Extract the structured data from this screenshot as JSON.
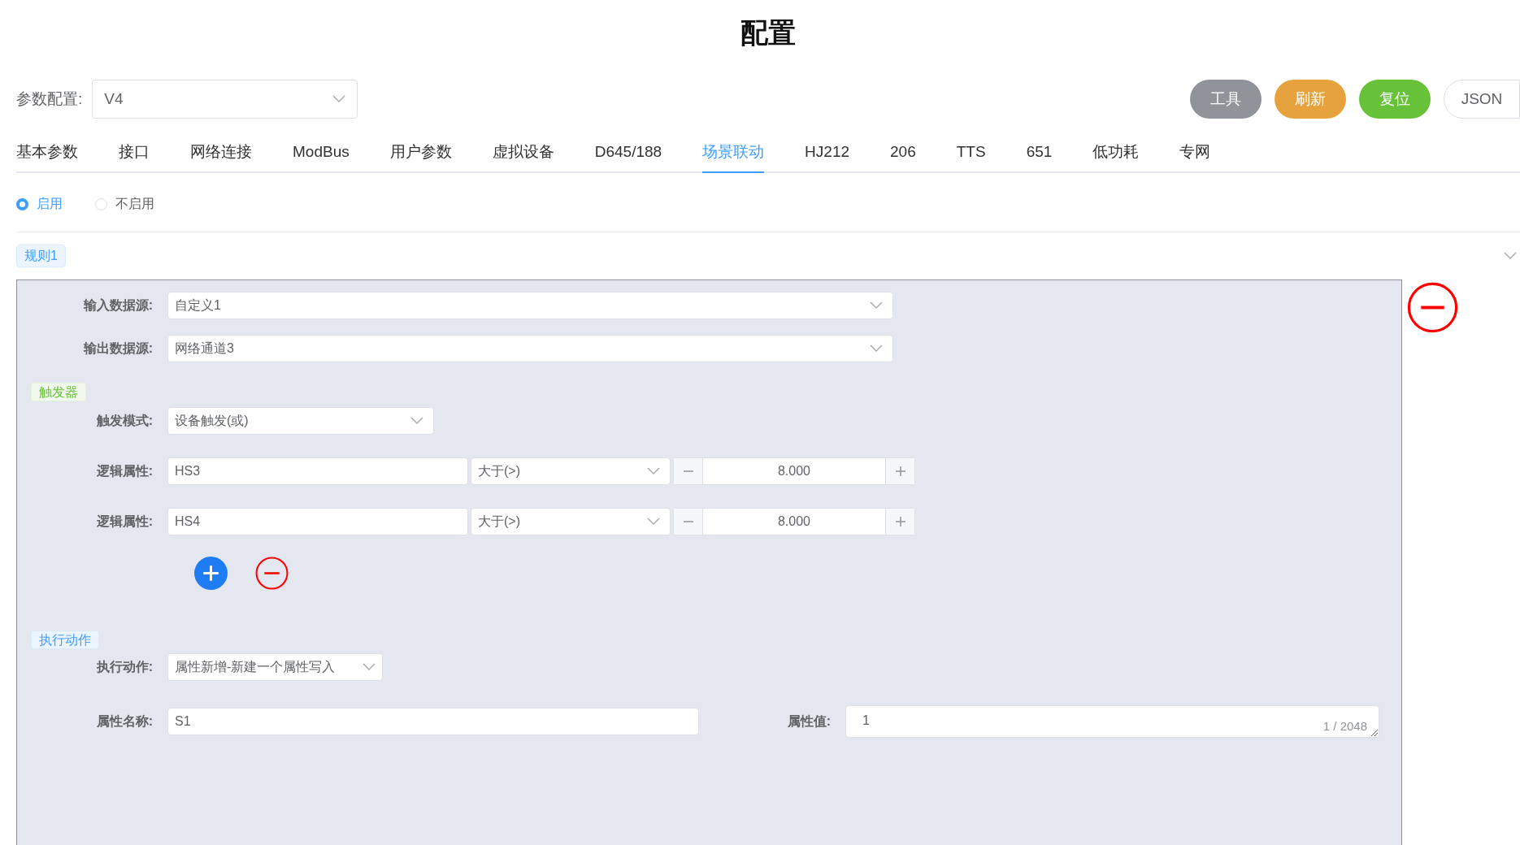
{
  "title": "配置",
  "config": {
    "label": "参数配置:",
    "value": "V4"
  },
  "buttons": [
    {
      "label": "工具",
      "kind": "info"
    },
    {
      "label": "刷新",
      "kind": "warning"
    },
    {
      "label": "复位",
      "kind": "success"
    },
    {
      "label": "JSON",
      "kind": "plain"
    }
  ],
  "tabs": [
    {
      "label": "基本参数",
      "selected": false
    },
    {
      "label": "接口",
      "selected": false
    },
    {
      "label": "网络连接",
      "selected": false
    },
    {
      "label": "ModBus",
      "selected": false
    },
    {
      "label": "用户参数",
      "selected": false
    },
    {
      "label": "虚拟设备",
      "selected": false
    },
    {
      "label": "D645/188",
      "selected": false
    },
    {
      "label": "场景联动",
      "selected": true
    },
    {
      "label": "HJ212",
      "selected": false
    },
    {
      "label": "206",
      "selected": false
    },
    {
      "label": "TTS",
      "selected": false
    },
    {
      "label": "651",
      "selected": false
    },
    {
      "label": "低功耗",
      "selected": false
    },
    {
      "label": "专网",
      "selected": false
    }
  ],
  "enable_options": [
    {
      "label": "启用",
      "selected": true
    },
    {
      "label": "不启用",
      "selected": false
    }
  ],
  "rule": {
    "tag": "规则1",
    "input_source": {
      "label": "输入数据源:",
      "value": "自定义1"
    },
    "output_source": {
      "label": "输出数据源:",
      "value": "网络通道3"
    },
    "trigger": {
      "tag": "触发器",
      "mode_label": "触发模式:",
      "mode": "设备触发(或)",
      "conditions": [
        {
          "label": "逻辑属性:",
          "attribute": "HS3",
          "operator": "大于(>)",
          "value": "8.000"
        },
        {
          "label": "逻辑属性:",
          "attribute": "HS4",
          "operator": "大于(>)",
          "value": "8.000"
        }
      ]
    },
    "action": {
      "tag": "执行动作",
      "action_label": "执行动作:",
      "action": "属性新增-新建一个属性写入",
      "name_label": "属性名称:",
      "name": "S1",
      "value_label": "属性值:",
      "value": "1",
      "counter": "1 / 2048"
    }
  }
}
